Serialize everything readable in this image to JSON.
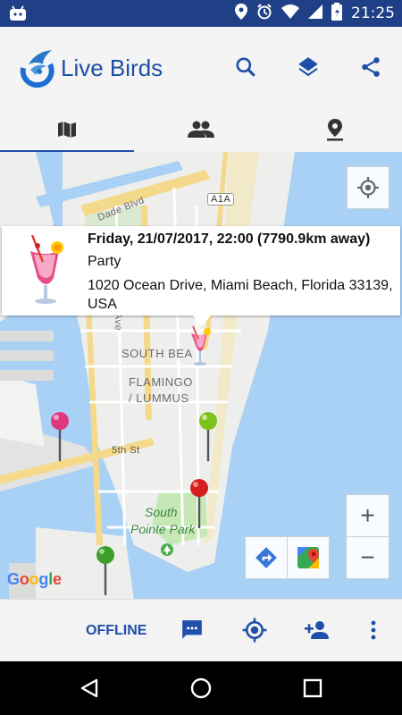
{
  "status_bar": {
    "time": "21:25"
  },
  "app_bar": {
    "title": "Live Birds",
    "actions": [
      "search-icon",
      "layers-icon",
      "share-icon"
    ]
  },
  "tabs": [
    {
      "icon": "map-icon",
      "selected": true
    },
    {
      "icon": "people-icon",
      "selected": false
    },
    {
      "icon": "place-icon",
      "selected": false
    }
  ],
  "map": {
    "street_labels": [
      "Dade Blvd",
      "A1A",
      "Ave",
      "5th St"
    ],
    "area_labels": [
      "SOUTH BEA",
      "FLAMINGO",
      "/ LUMMUS"
    ],
    "park_label": [
      "South",
      "Pointe Park"
    ],
    "attribution": "Google",
    "popup": {
      "heading": "Friday, 21/07/2017, 22:00 (7790.9km away)",
      "category": "Party",
      "address": "1020 Ocean Drive, Miami Beach, Florida 33139, USA"
    },
    "controls": {
      "zoom_in": "+",
      "zoom_out": "−"
    },
    "colors": {
      "water": "#a9d0f5",
      "land": "#eeeeec",
      "road": "#f5d98a",
      "park": "#c6e8b6",
      "pin_pink": "#e0387e",
      "pin_green": "#3d9e2a",
      "pin_red": "#d42020"
    }
  },
  "bottom_bar": {
    "offline_label": "OFFLINE"
  }
}
